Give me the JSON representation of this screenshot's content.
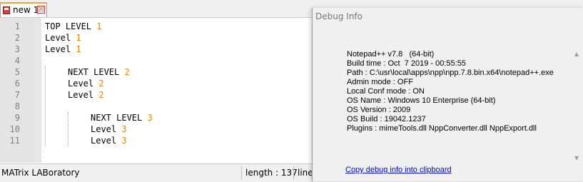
{
  "tab": {
    "label": "new 1",
    "close_glyph": "☒"
  },
  "editor": {
    "line_numbers": [
      "1",
      "2",
      "3",
      "4",
      "5",
      "6",
      "7",
      "8",
      "9",
      "10",
      "11"
    ],
    "lines": [
      {
        "text": "TOP LEVEL ",
        "num": "1"
      },
      {
        "text": "Level ",
        "num": "1"
      },
      {
        "text": "Level ",
        "num": "1"
      },
      {
        "text": "",
        "num": ""
      },
      {
        "text": "NEXT LEVEL ",
        "num": "2"
      },
      {
        "text": "Level ",
        "num": "2"
      },
      {
        "text": "Level ",
        "num": "2"
      },
      {
        "text": "",
        "num": ""
      },
      {
        "text": "NEXT LEVEL ",
        "num": "3"
      },
      {
        "text": "Level ",
        "num": "3"
      },
      {
        "text": "Level ",
        "num": "3"
      }
    ]
  },
  "statusbar": {
    "language": "MATrix LABoratory",
    "length": "length : 137",
    "line": "line"
  },
  "debug_dialog": {
    "title": "Debug Info",
    "lines": [
      "Notepad++ v7.8   (64-bit)",
      "Build time : Oct  7 2019 - 00:55:55",
      "Path : C:\\usr\\local\\apps\\npp\\npp.7.8.bin.x64\\notepad++.exe",
      "Admin mode : OFF",
      "Local Conf mode : ON",
      "OS Name : Windows 10 Enterprise (64-bit)",
      "OS Version : 2009",
      "OS Build : 19042.1237",
      "Plugins : mimeTools.dll NppConverter.dll NppExport.dll"
    ],
    "copy_link": "Copy debug info into clipboard"
  },
  "colors": {
    "number": "#ff8000",
    "link": "#0000ff",
    "current_line": "#e8e8ff"
  }
}
